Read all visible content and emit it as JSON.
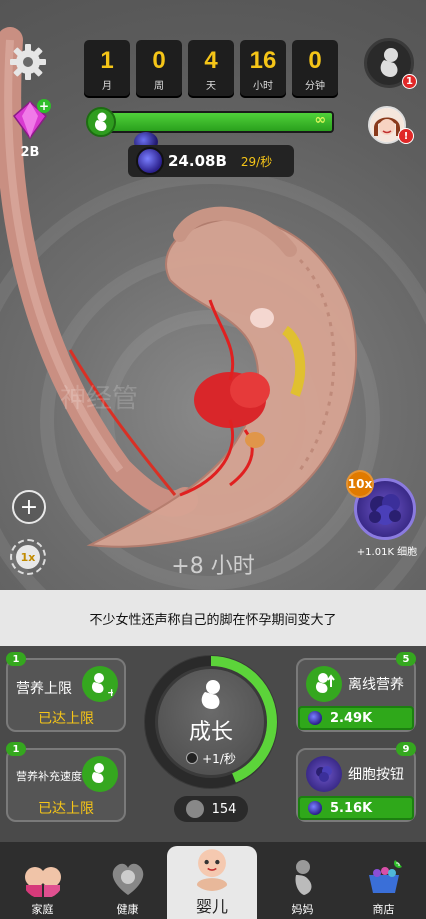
{
  "timer": [
    {
      "value": "1",
      "unit": "月"
    },
    {
      "value": "0",
      "unit": "周"
    },
    {
      "value": "4",
      "unit": "天"
    },
    {
      "value": "16",
      "unit": "小时"
    },
    {
      "value": "0",
      "unit": "分钟"
    }
  ],
  "progress": {
    "value": "∞",
    "fill_fraction": 1.0
  },
  "cells": {
    "amount": "24.08B",
    "rate": "29/秒"
  },
  "gems": {
    "amount": "2B"
  },
  "notifications": {
    "fetus_badge": "1",
    "mom_badge": "!"
  },
  "watermark": "神经管",
  "speed": {
    "label": "1x"
  },
  "boost": {
    "multiplier": "10x",
    "label": "+1.01K 细胞"
  },
  "float_text": "+8 小时",
  "tip": "不少女性还声称自己的脚在怀孕期间变大了",
  "left_cards": [
    {
      "level": "1",
      "title": "营养上限",
      "status": "已达上限"
    },
    {
      "level": "1",
      "title": "营养补充速度",
      "status": "已达上限"
    }
  ],
  "right_cards": [
    {
      "level": "5",
      "title": "离线营养",
      "cost": "2.49K"
    },
    {
      "level": "9",
      "title": "细胞按钮",
      "cost": "5.16K"
    }
  ],
  "grow": {
    "label": "成长",
    "rate": "+1/秒",
    "count": "154"
  },
  "nav": [
    {
      "label": "家庭"
    },
    {
      "label": "健康"
    },
    {
      "label": "婴儿"
    },
    {
      "label": "妈妈"
    },
    {
      "label": "商店"
    }
  ],
  "colors": {
    "accent_green": "#35a71f",
    "timer_yellow": "#f5c518",
    "badge_red": "#e02828",
    "cell_purple": "#3a2a88"
  }
}
